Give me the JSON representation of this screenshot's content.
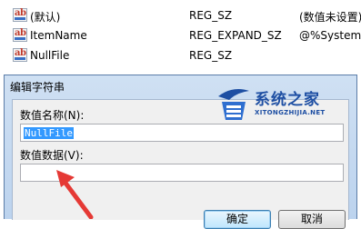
{
  "registry": {
    "rows": [
      {
        "name": "(默认)",
        "type": "REG_SZ",
        "data": "(数值未设置)"
      },
      {
        "name": "ItemName",
        "type": "REG_EXPAND_SZ",
        "data": "@%SystemR"
      },
      {
        "name": "NullFile",
        "type": "REG_SZ",
        "data": ""
      }
    ]
  },
  "dialog": {
    "title": "编辑字符串",
    "name_label": "数值名称(N):",
    "name_value": "NullFile",
    "data_label": "数值数据(V):",
    "data_value": "",
    "ok_label": "确定",
    "cancel_label": "取消"
  },
  "watermark": {
    "cn": "系统之家",
    "url": "XITONGZHIJIA.NET"
  },
  "colors": {
    "selection": "#3399ff",
    "arrow": "#e53935",
    "watermark": "#1e4fa3"
  }
}
